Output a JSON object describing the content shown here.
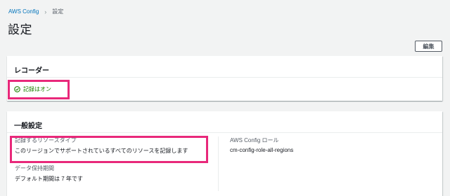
{
  "breadcrumb": {
    "root": "AWS Config",
    "current": "設定"
  },
  "page": {
    "title": "設定",
    "edit_label": "編集"
  },
  "recorder": {
    "title": "レコーダー",
    "status": "記録はオン",
    "status_icon": "check-circle-icon",
    "status_color": "#1d8102"
  },
  "general": {
    "title": "一般設定",
    "resource_types_label": "記録するリソースタイプ",
    "resource_types_value": "このリージョンでサポートされているすべてのリソースを記録します",
    "retention_label": "データ保持期間",
    "retention_value": "デフォルト期間は 7 年です",
    "role_label": "AWS Config ロール",
    "role_value": "cm-config-role-all-regions"
  },
  "colors": {
    "link": "#0073bb",
    "highlight": "#e8287a"
  }
}
